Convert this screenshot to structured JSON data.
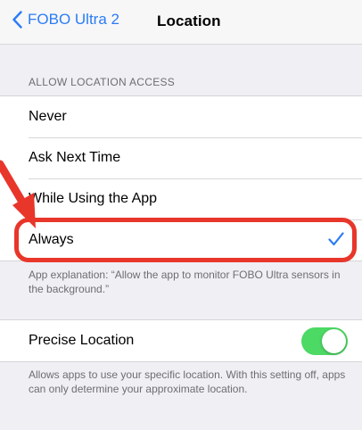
{
  "nav": {
    "back_label": "FOBO Ultra 2",
    "title": "Location"
  },
  "location_access": {
    "header": "ALLOW LOCATION ACCESS",
    "options": [
      {
        "label": "Never",
        "selected": false
      },
      {
        "label": "Ask Next Time",
        "selected": false
      },
      {
        "label": "While Using the App",
        "selected": false
      },
      {
        "label": "Always",
        "selected": true
      }
    ],
    "explanation": "App explanation: “Allow the app to monitor FOBO Ultra sensors in the background.”"
  },
  "precise_location": {
    "label": "Precise Location",
    "enabled": true,
    "description": "Allows apps to use your specific location. With this setting off, apps can only determine your approximate location."
  },
  "colors": {
    "accent": "#2b7cf6",
    "toggle_on": "#4cd964",
    "highlight": "#e8362b"
  }
}
